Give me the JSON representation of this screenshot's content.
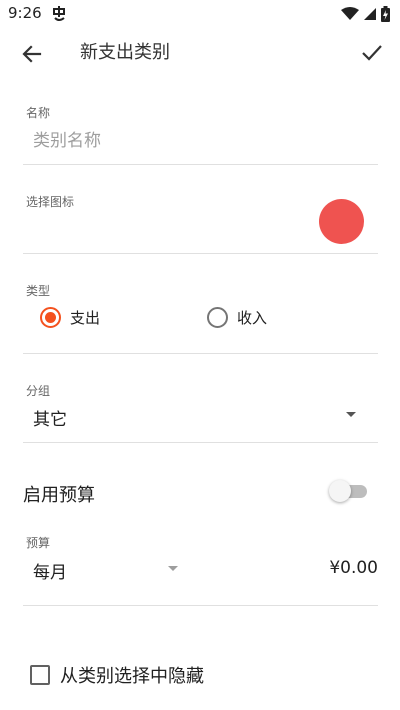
{
  "status_bar": {
    "time": "9:26",
    "notification_icon": "chinese-char-notification-icon",
    "icons": [
      "wifi-icon",
      "cell-signal-icon",
      "battery-charging-icon"
    ]
  },
  "app_bar": {
    "title": "新支出类别",
    "back_icon": "arrow-back-icon",
    "done_icon": "check-icon"
  },
  "name_field": {
    "label": "名称",
    "value": "",
    "placeholder": "类别名称"
  },
  "icon_field": {
    "label": "选择图标",
    "selected_color": "#ef5350"
  },
  "type_field": {
    "label": "类型",
    "options": [
      {
        "label": "支出",
        "checked": true
      },
      {
        "label": "收入",
        "checked": false
      }
    ],
    "accent_color": "#f4511e"
  },
  "group_field": {
    "label": "分组",
    "value": "其它"
  },
  "budget": {
    "title": "启用预算",
    "enabled": false,
    "label": "预算",
    "period": "每月",
    "amount": "¥0.00"
  },
  "hide_option": {
    "label": "从类别选择中隐藏",
    "checked": false
  }
}
